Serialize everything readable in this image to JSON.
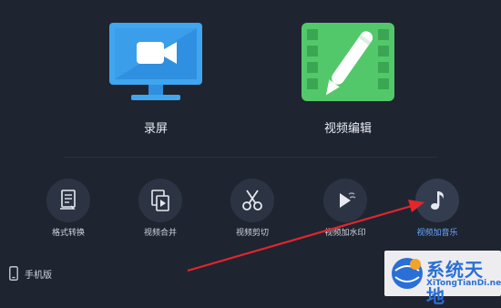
{
  "main_actions": [
    {
      "label": "录屏",
      "icon": "monitor-camera-icon"
    },
    {
      "label": "视频编辑",
      "icon": "film-pen-icon"
    }
  ],
  "tools": [
    {
      "label": "格式转换",
      "icon": "document-convert-icon"
    },
    {
      "label": "视频合并",
      "icon": "video-merge-icon"
    },
    {
      "label": "视频剪切",
      "icon": "scissors-icon"
    },
    {
      "label": "视频加水印",
      "icon": "watermark-play-icon"
    },
    {
      "label": "视频加音乐",
      "icon": "music-note-icon"
    }
  ],
  "mobile": {
    "label": "手机版",
    "icon": "phone-icon"
  },
  "watermark": {
    "title": "系统天地",
    "url": "XiTongTianDi.net"
  },
  "colors": {
    "background": "#1f2431",
    "record_blue": "#3fa6ef",
    "edit_green": "#53c86a",
    "highlight": "#6aa9ff",
    "arrow": "#e2262b"
  }
}
